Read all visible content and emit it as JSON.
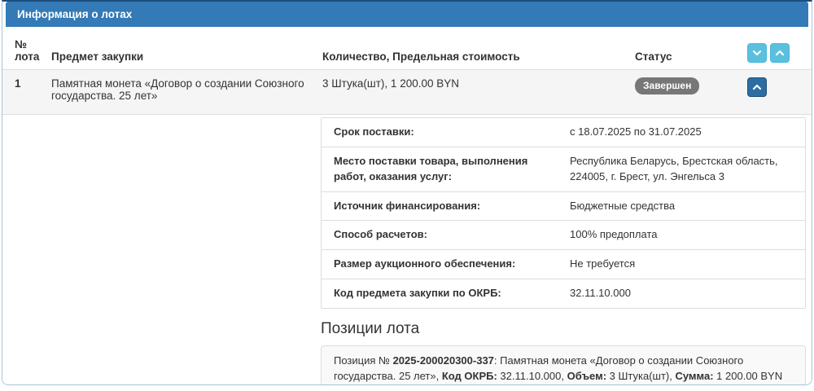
{
  "panel": {
    "title": "Информация о лотах"
  },
  "columns": {
    "lot_number": "№ лота",
    "subject": "Предмет закупки",
    "quantity_cost": "Количество, Предельная стоимость",
    "status": "Статус"
  },
  "lot": {
    "number": "1",
    "subject": "Памятная монета «Договор о создании Союзного государства. 25 лет»",
    "quantity_cost": "3 Штука(шт), 1 200.00 BYN",
    "status": "Завершен"
  },
  "details": {
    "rows": [
      {
        "label": "Срок поставки:",
        "value": "с 18.07.2025 по 31.07.2025"
      },
      {
        "label": "Место поставки товара, выполнения работ, оказания услуг:",
        "value": "Республика Беларусь, Брестская область, 224005, г. Брест, ул. Энгельса 3"
      },
      {
        "label": "Источник финансирования:",
        "value": "Бюджетные средства"
      },
      {
        "label": "Способ расчетов:",
        "value": "100% предоплата"
      },
      {
        "label": "Размер аукционного обеспечения:",
        "value": "Не требуется"
      },
      {
        "label": "Код предмета закупки по ОКРБ:",
        "value": "32.11.10.000"
      }
    ]
  },
  "positions": {
    "title": "Позиции лота",
    "item": {
      "prefix": "Позиция № ",
      "number": "2025-200020300-337",
      "after_number": ": Памятная монета «Договор о создании Союзного государства. 25 лет», ",
      "okrb_label": "Код ОКРБ:",
      "okrb_value": " 32.11.10.000, ",
      "volume_label": "Объем:",
      "volume_value": " 3 Штука(шт), ",
      "sum_label": "Сумма:",
      "sum_value": " 1 200.00 BYN"
    }
  },
  "icons": {
    "sort_desc": "chevron-down-icon",
    "sort_asc": "chevron-up-icon",
    "collapse": "chevron-up-icon"
  },
  "colors": {
    "panel_header_bg": "#337ab7",
    "panel_top_border": "#1c4d7c",
    "outer_border": "#a8c3d6",
    "sort_button_bg": "#5bc0de",
    "collapse_button_bg": "#2e6da4",
    "status_badge_bg": "#777777",
    "row_stripe_bg": "#f5f5f5",
    "divider": "#dddddd"
  }
}
